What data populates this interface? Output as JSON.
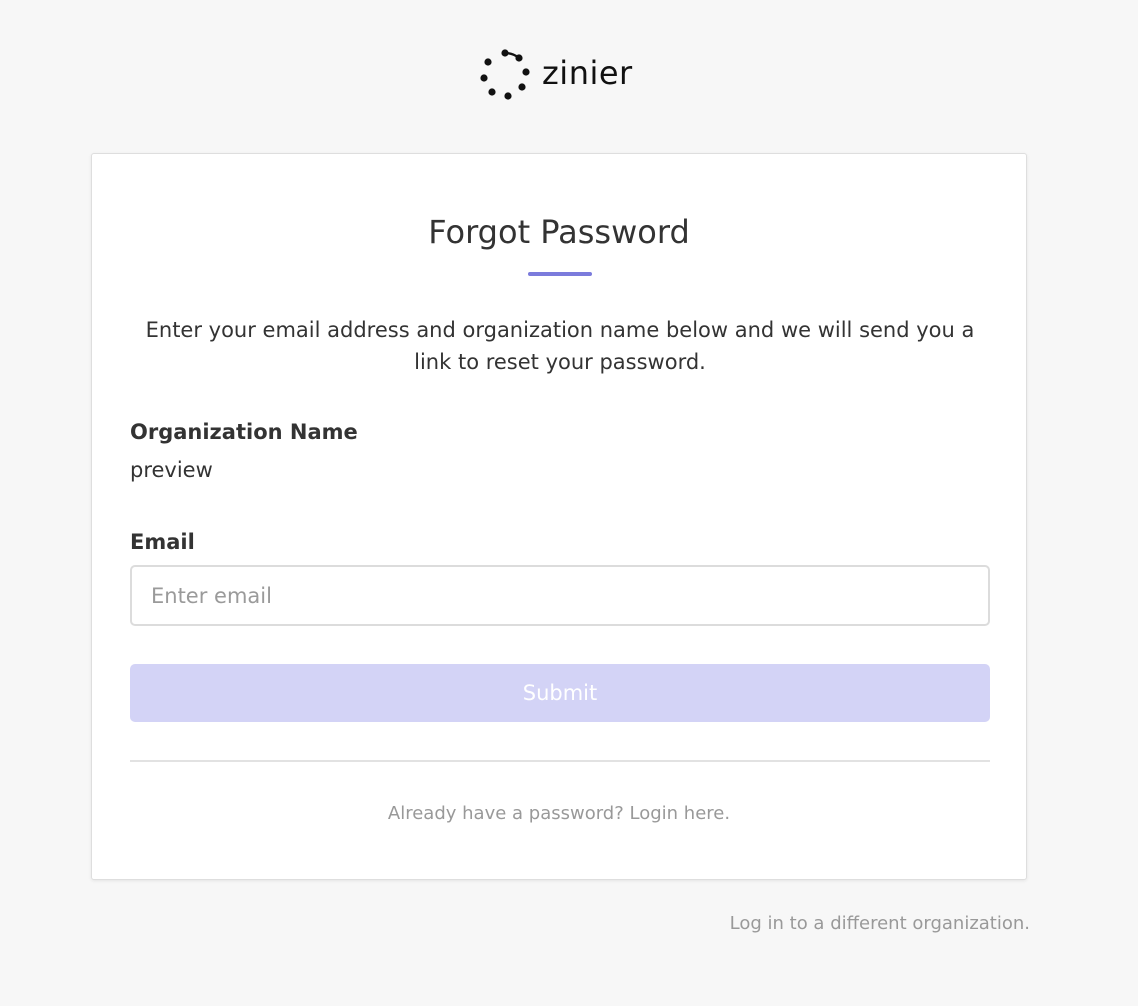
{
  "logo": {
    "text": "zinier",
    "icon": "dotted-circle-logo-icon"
  },
  "card": {
    "title": "Forgot Password",
    "description": "Enter your email address and organization name below and we will send you a link to reset your password.",
    "organization": {
      "label": "Organization Name",
      "value": "preview"
    },
    "email": {
      "label": "Email",
      "value": "",
      "placeholder": "Enter email"
    },
    "submit_label": "Submit",
    "login_link": "Already have a password? Login here."
  },
  "footer": {
    "different_org_link": "Log in to a different organization."
  },
  "colors": {
    "accent": "#7b7bdc",
    "submit_disabled_bg": "#d3d3f6",
    "background": "#f7f7f7",
    "muted_text": "#999999"
  }
}
